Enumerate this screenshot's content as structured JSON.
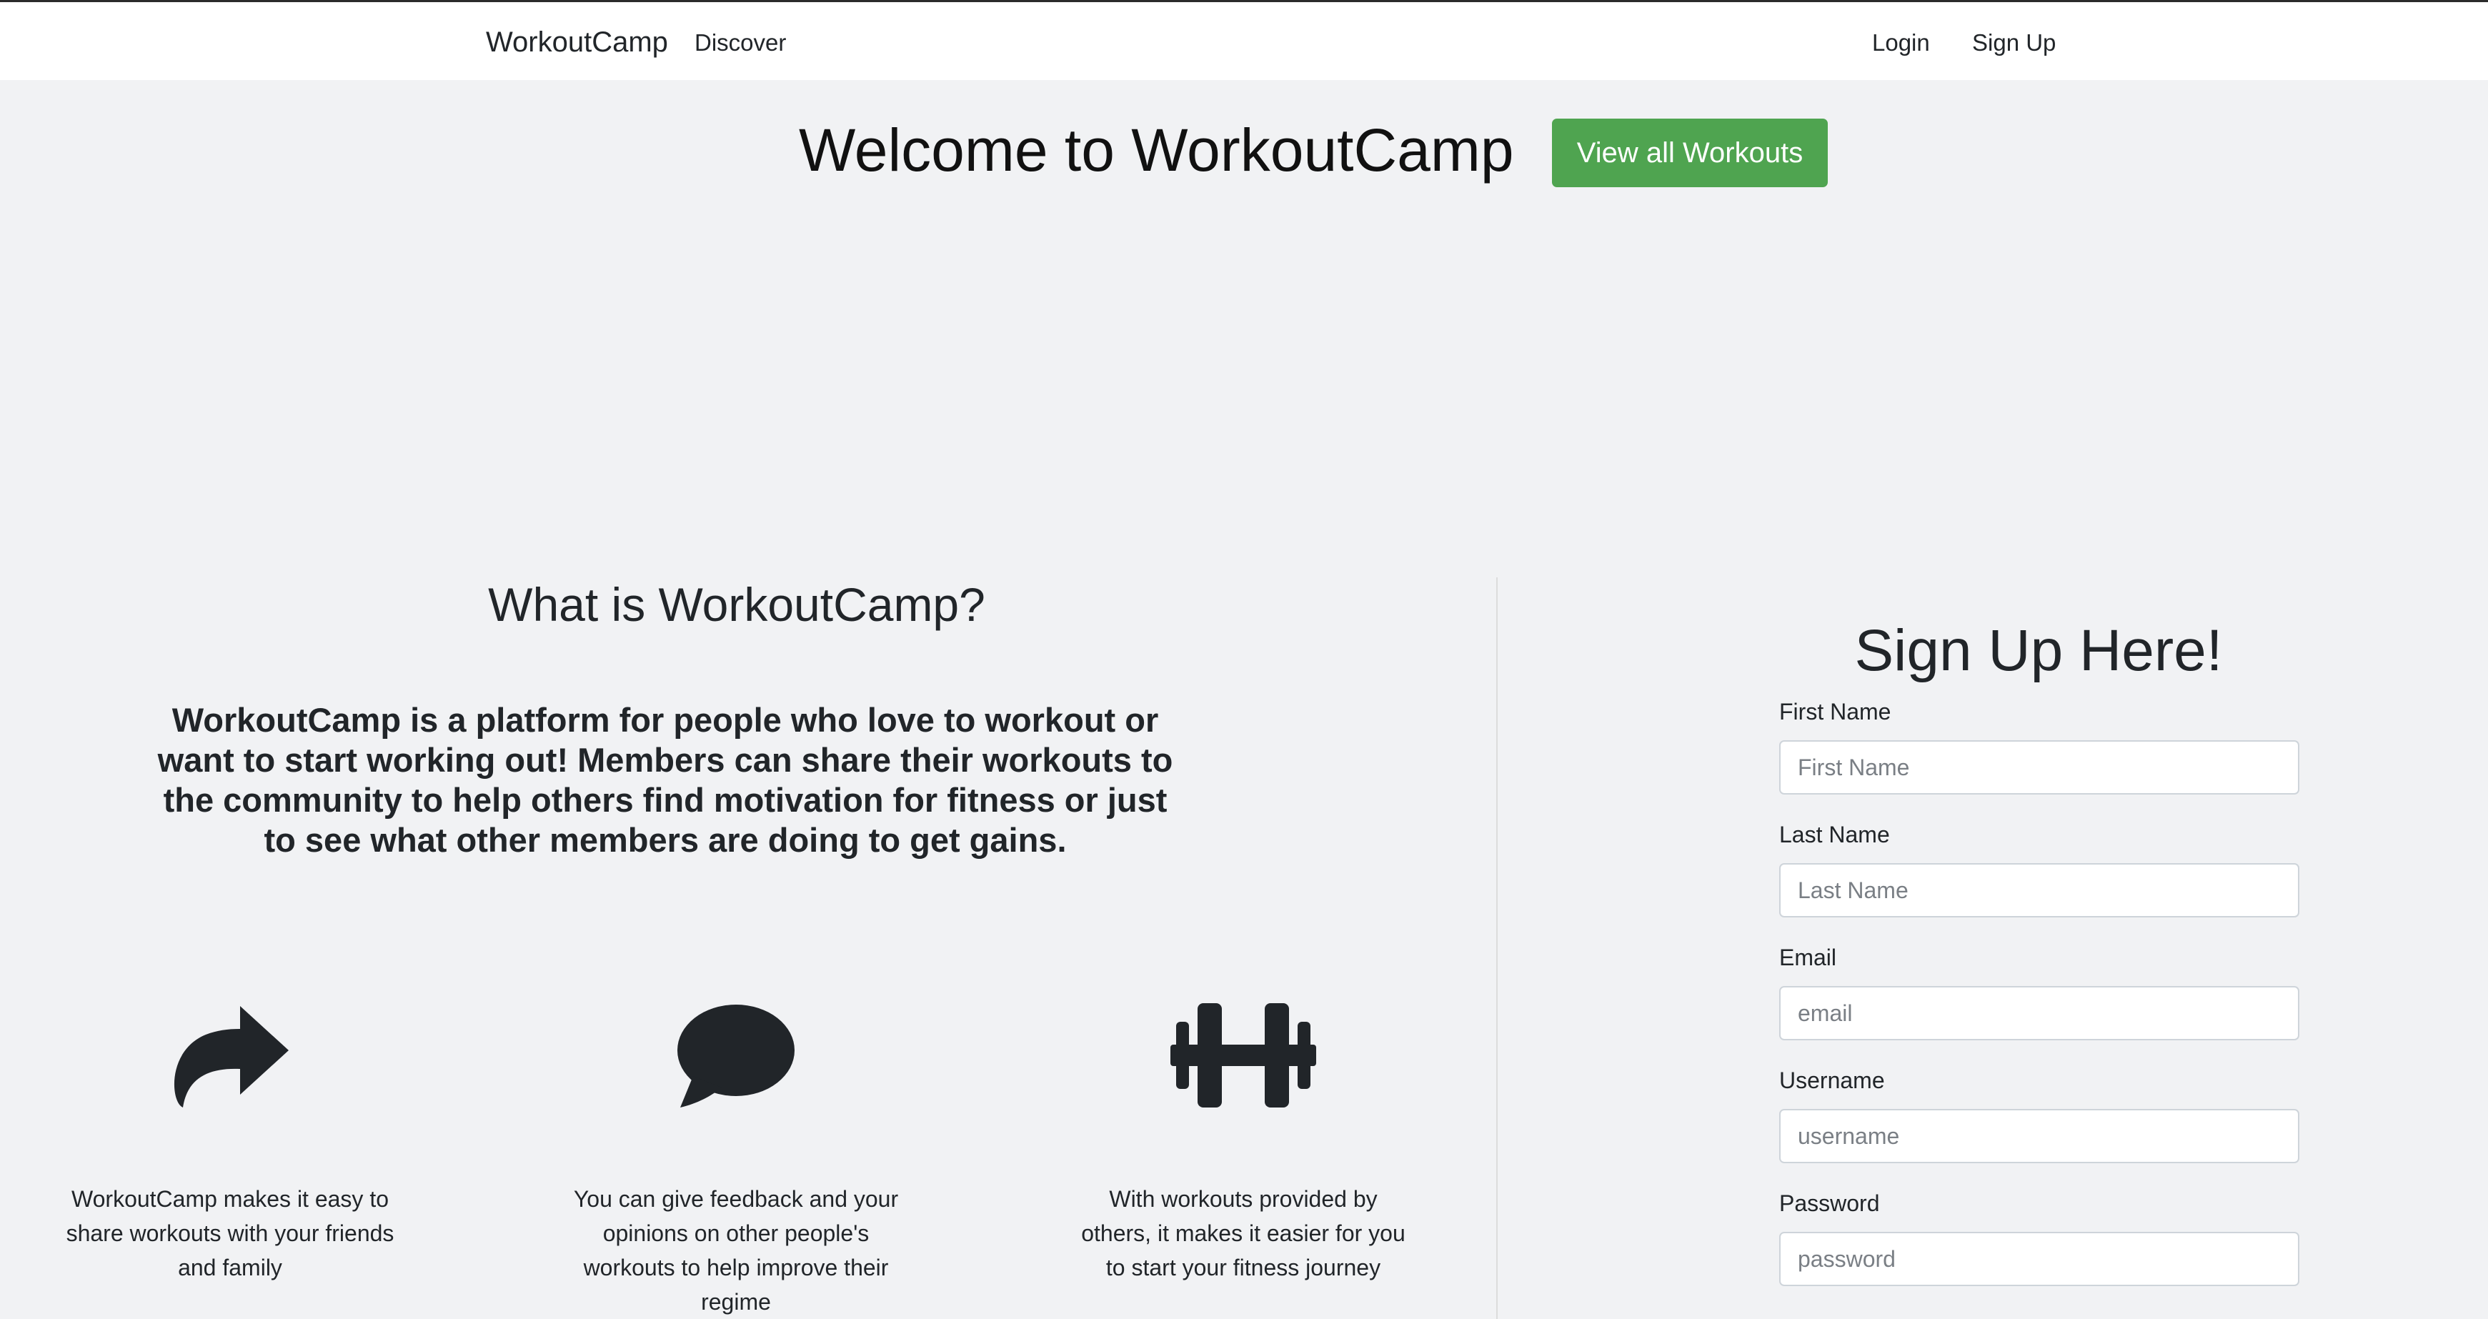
{
  "nav": {
    "brand": "WorkoutCamp",
    "discover": "Discover",
    "login": "Login",
    "signup": "Sign Up"
  },
  "hero": {
    "title": "Welcome to WorkoutCamp",
    "view_all_button": "View all Workouts"
  },
  "about": {
    "title": "What is WorkoutCamp?",
    "description": "WorkoutCamp is a platform for people who love to workout or want to start working out! Members can share their workouts to the community to help others find motivation for fitness or just to see what other members are doing to get gains."
  },
  "features": [
    {
      "icon": "share-icon",
      "text": "WorkoutCamp makes it easy to share workouts with your friends and family"
    },
    {
      "icon": "comment-icon",
      "text": "You can give feedback and your opinions on other people's workouts to help improve their regime"
    },
    {
      "icon": "dumbbell-icon",
      "text": "With workouts provided by others, it makes it easier for you to start your fitness journey"
    }
  ],
  "signup_form": {
    "title": "Sign Up Here!",
    "fields": [
      {
        "label": "First Name",
        "placeholder": "First Name"
      },
      {
        "label": "Last Name",
        "placeholder": "Last Name"
      },
      {
        "label": "Email",
        "placeholder": "email"
      },
      {
        "label": "Username",
        "placeholder": "username"
      },
      {
        "label": "Password",
        "placeholder": "password"
      }
    ]
  },
  "colors": {
    "accent_green": "#4fa450",
    "background": "#f1f2f4",
    "text": "#212529"
  }
}
